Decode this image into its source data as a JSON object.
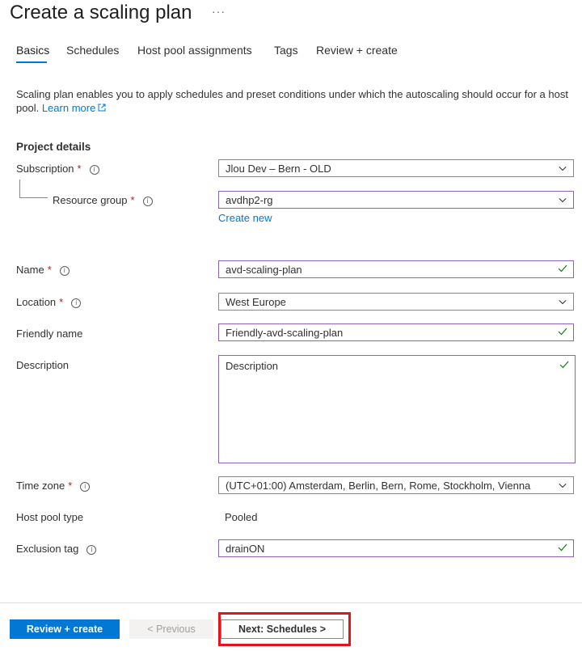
{
  "header": {
    "title": "Create a scaling plan",
    "more": "···"
  },
  "tabs": [
    {
      "label": "Basics",
      "active": true
    },
    {
      "label": "Schedules"
    },
    {
      "label": "Host pool assignments"
    },
    {
      "label": "Tags"
    },
    {
      "label": "Review + create"
    }
  ],
  "intro": {
    "text": "Scaling plan enables you to apply schedules and preset conditions under which the autoscaling should occur for a host pool.",
    "link": "Learn more"
  },
  "project": {
    "heading": "Project details",
    "subscription": {
      "label": "Subscription",
      "value": "Jlou Dev – Bern - OLD"
    },
    "resource_group": {
      "label": "Resource group",
      "value": "avdhp2-rg",
      "create_new": "Create new"
    }
  },
  "form": {
    "name": {
      "label": "Name",
      "value": "avd-scaling-plan"
    },
    "location": {
      "label": "Location",
      "value": "West Europe"
    },
    "friendly_name": {
      "label": "Friendly name",
      "value": "Friendly-avd-scaling-plan"
    },
    "description": {
      "label": "Description",
      "value": "Description"
    },
    "time_zone": {
      "label": "Time zone",
      "value": "(UTC+01:00) Amsterdam, Berlin, Bern, Rome, Stockholm, Vienna"
    },
    "host_pool_type": {
      "label": "Host pool type",
      "value": "Pooled"
    },
    "exclusion_tag": {
      "label": "Exclusion tag",
      "value": "drainON"
    }
  },
  "footer": {
    "review_create": "Review + create",
    "previous": "< Previous",
    "next": "Next: Schedules >"
  },
  "colors": {
    "accent": "#0078d4",
    "focus_border": "#8764b8",
    "valid_check": "#107c10",
    "highlight": "#e3141b",
    "required": "#a4262c"
  }
}
